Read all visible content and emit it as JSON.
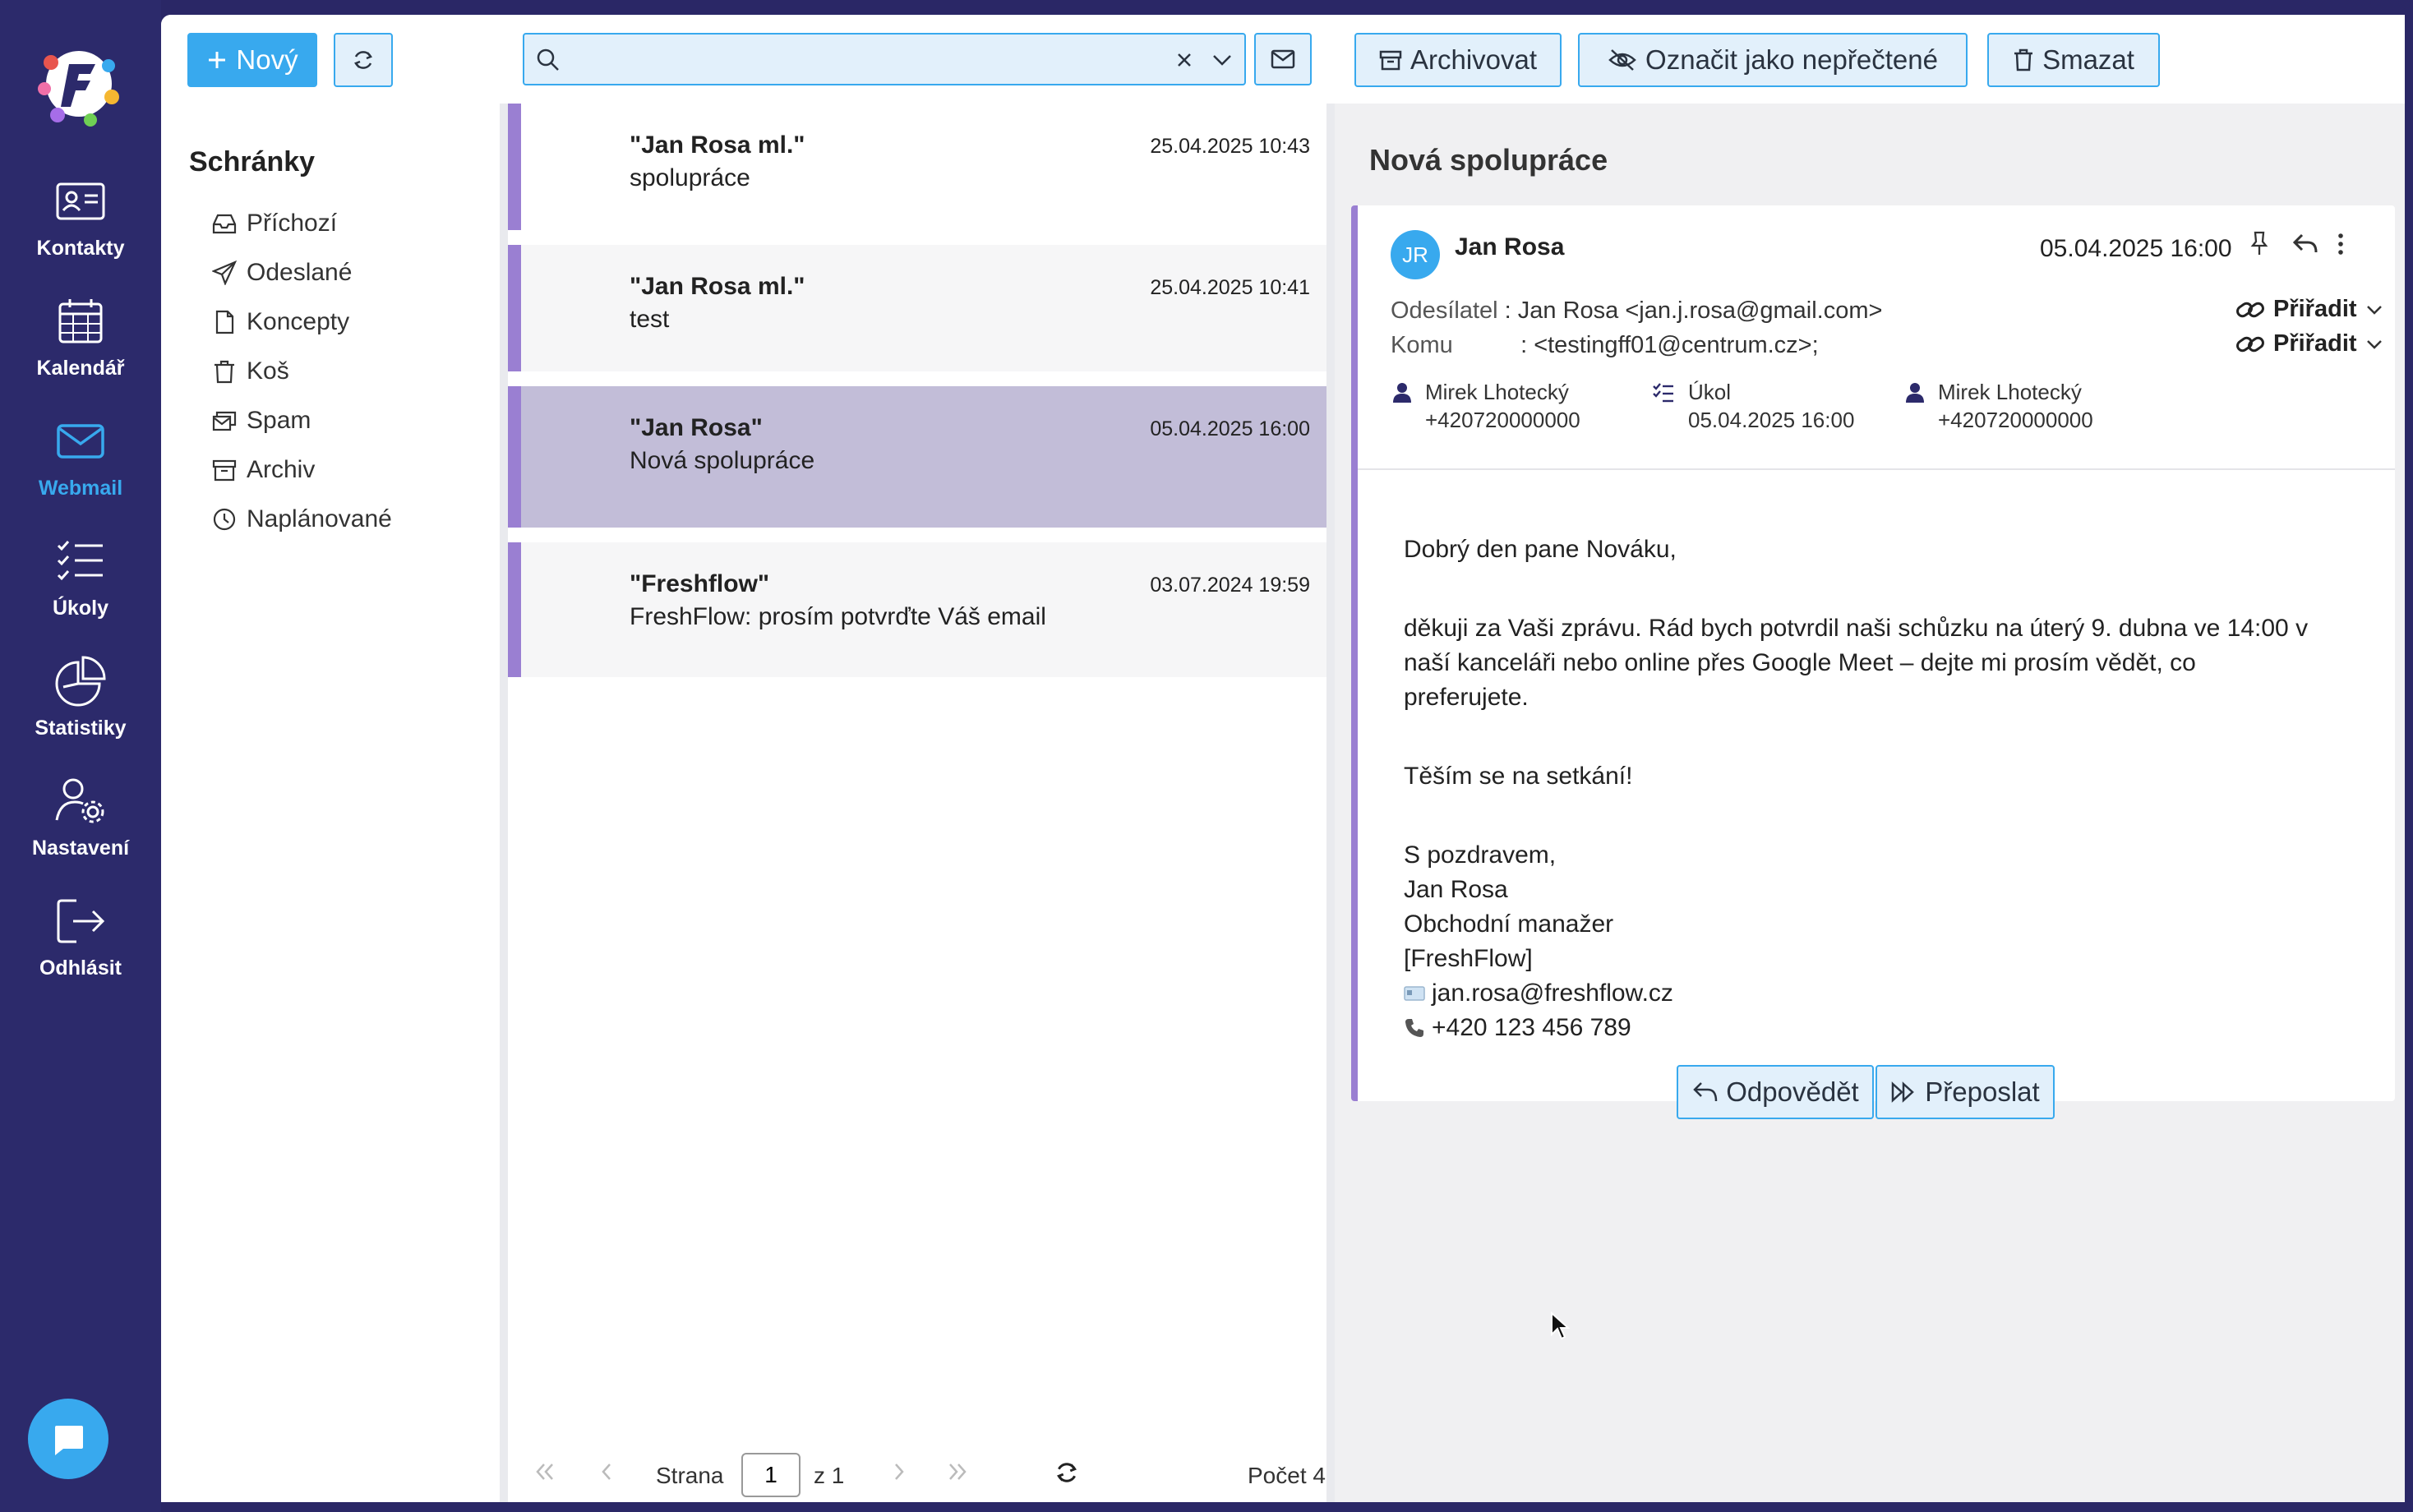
{
  "nav": [
    {
      "label": "Kontakty",
      "icon": "contacts-icon"
    },
    {
      "label": "Kalendář",
      "icon": "calendar-icon"
    },
    {
      "label": "Webmail",
      "icon": "mail-icon",
      "active": true
    },
    {
      "label": "Úkoly",
      "icon": "tasks-icon"
    },
    {
      "label": "Statistiky",
      "icon": "chart-icon"
    },
    {
      "label": "Nastavení",
      "icon": "user-settings-icon"
    },
    {
      "label": "Odhlásit",
      "icon": "logout-icon"
    }
  ],
  "toolbar": {
    "new_label": "Nový",
    "search_value": "",
    "archive_label": "Archivovat",
    "mark_unread_label": "Označit jako nepřečtené",
    "delete_label": "Smazat"
  },
  "folders": {
    "title": "Schránky",
    "items": [
      {
        "label": "Příchozí",
        "icon": "inbox-icon"
      },
      {
        "label": "Odeslané",
        "icon": "send-icon"
      },
      {
        "label": "Koncepty",
        "icon": "file-icon"
      },
      {
        "label": "Koš",
        "icon": "trash-icon"
      },
      {
        "label": "Spam",
        "icon": "spam-icon"
      },
      {
        "label": "Archiv",
        "icon": "archive-icon"
      },
      {
        "label": "Naplánované",
        "icon": "clock-icon"
      }
    ]
  },
  "messages": [
    {
      "from": "\"Jan Rosa ml.\"",
      "subject": "spolupráce",
      "date": "25.04.2025 10:43"
    },
    {
      "from": "\"Jan Rosa ml.\"",
      "subject": "test",
      "date": "25.04.2025 10:41"
    },
    {
      "from": "\"Jan Rosa\"",
      "subject": "Nová spolupráce",
      "date": "05.04.2025 16:00",
      "selected": true
    },
    {
      "from": "\"Freshflow\"",
      "subject": "FreshFlow: prosím potvrďte Váš email",
      "date": "03.07.2024 19:59"
    }
  ],
  "pager": {
    "page_label": "Strana",
    "page": "1",
    "of_label": "z 1",
    "count_label": "Počet 4"
  },
  "reader": {
    "title": "Nová spolupráce",
    "initials": "JR",
    "sender": "Jan Rosa",
    "date": "05.04.2025 16:00",
    "from_label": "Odesílatel",
    "from_value": "Jan Rosa <jan.j.rosa@gmail.com>",
    "to_label": "Komu",
    "to_value": "<testingff01@centrum.cz>;",
    "assign_label": "Přiřadit",
    "meta": [
      {
        "line1": "Mirek Lhotecký",
        "line2": "+420720000000",
        "icon": "person-icon"
      },
      {
        "line1": "Úkol",
        "line2": "05.04.2025 16:00",
        "icon": "task-list-icon"
      },
      {
        "line1": "Mirek Lhotecký",
        "line2": "+420720000000",
        "icon": "person-icon"
      }
    ],
    "body": [
      "Dobrý den pane Nováku,",
      "děkuji za Vaši zprávu. Rád bych potvrdil naši schůzku na úterý 9. dubna ve 14:00 v",
      "naší kanceláři nebo online přes Google Meet – dejte mi prosím vědět, co",
      "preferujete.",
      "Těším se na setkání!",
      "S pozdravem,",
      "Jan Rosa",
      "Obchodní manažer",
      "[FreshFlow]",
      "jan.rosa@freshflow.cz",
      "+420 123 456 789"
    ],
    "reply_label": "Odpovědět",
    "forward_label": "Přeposlat"
  },
  "colors": {
    "accent": "#38a9ee",
    "rail": "#2c2a6b",
    "unread_bar": "#9a7fd2",
    "selected_row": "#c2bdd8"
  }
}
